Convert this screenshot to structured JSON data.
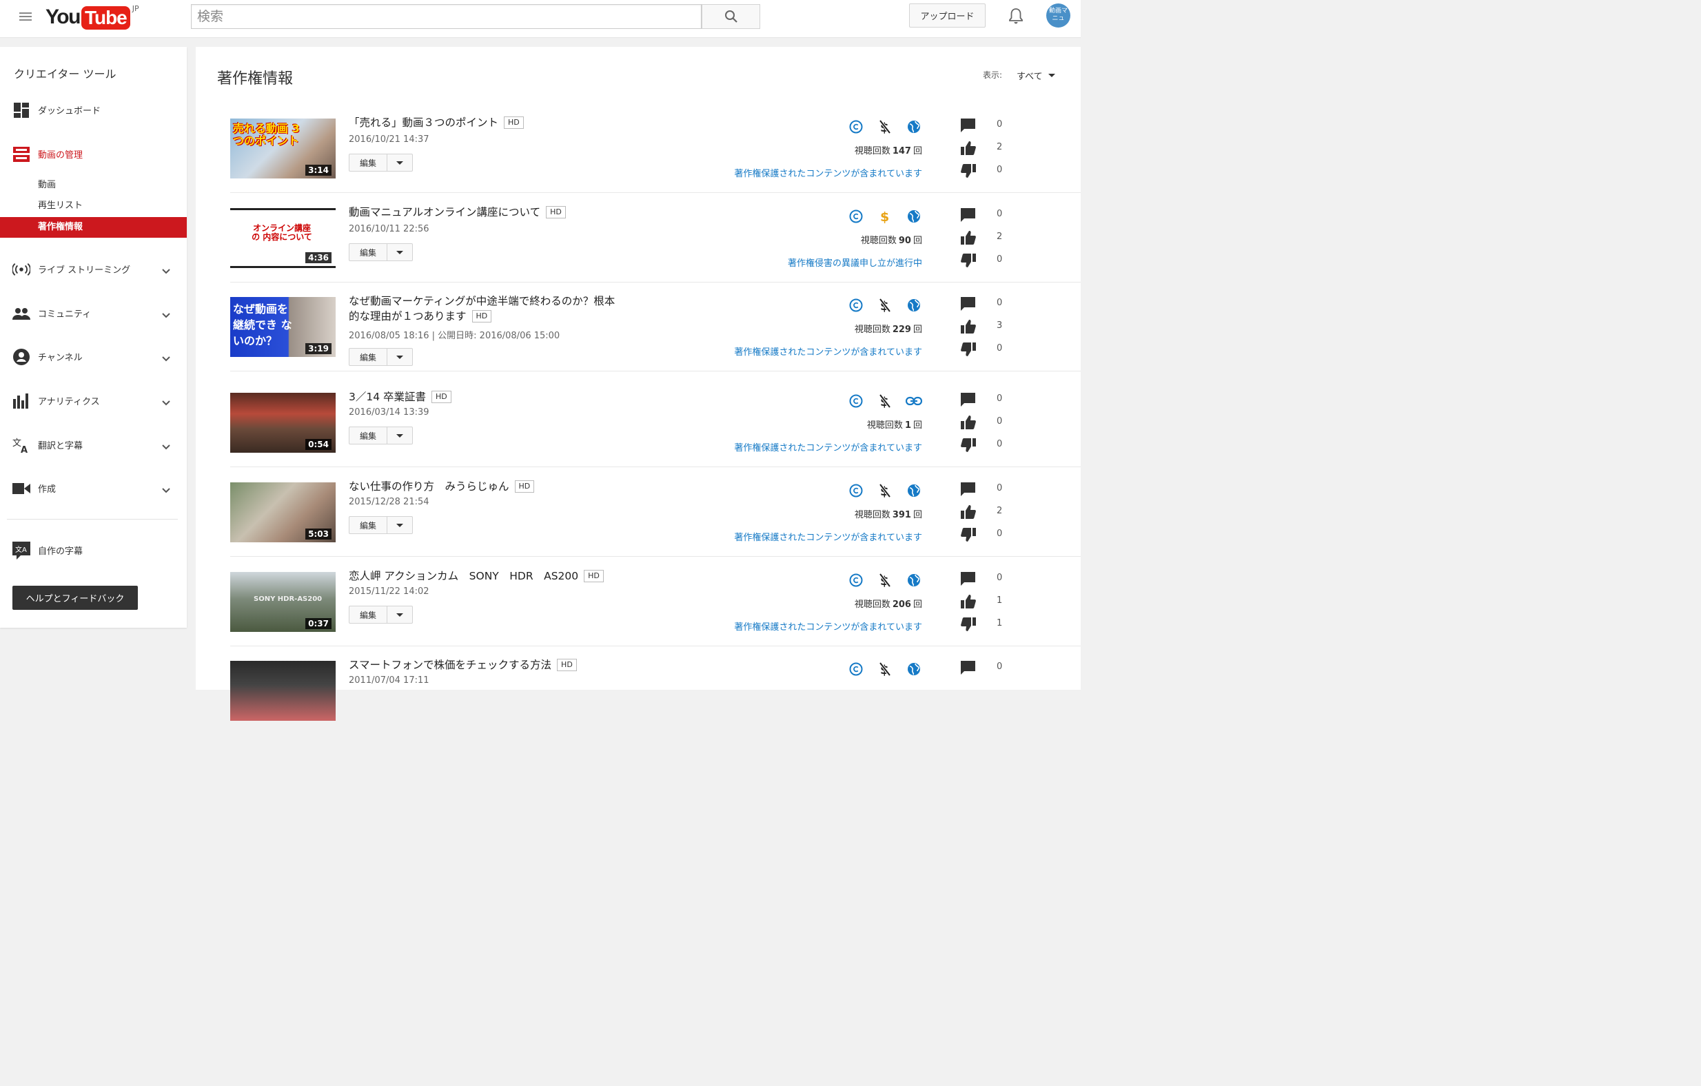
{
  "header": {
    "logo_you": "You",
    "logo_tube": "Tube",
    "logo_region": "JP",
    "search_placeholder": "検索",
    "upload_label": "アップロード",
    "avatar_text": "動画マニュ"
  },
  "sidebar": {
    "title": "クリエイター ツール",
    "items": [
      {
        "label": "ダッシュボード",
        "icon": "dashboard-icon"
      },
      {
        "label": "動画の管理",
        "icon": "video-manager-icon",
        "active": true
      },
      {
        "label": "ライブ ストリーミング",
        "icon": "live-streaming-icon"
      },
      {
        "label": "コミュニティ",
        "icon": "community-icon"
      },
      {
        "label": "チャンネル",
        "icon": "channel-icon"
      },
      {
        "label": "アナリティクス",
        "icon": "analytics-icon"
      },
      {
        "label": "翻訳と字幕",
        "icon": "translate-icon"
      },
      {
        "label": "作成",
        "icon": "create-icon"
      }
    ],
    "sub_items": [
      "動画",
      "再生リスト",
      "著作権情報"
    ],
    "own_subtitles": "自作の字幕",
    "help_label": "ヘルプとフィードバック"
  },
  "main": {
    "title": "著作権情報",
    "filter_label": "表示:",
    "filter_value": "すべて",
    "hd_label": "HD",
    "edit_label": "編集",
    "views_prefix": "視聴回数",
    "views_suffix": "回"
  },
  "colors": {
    "accent_red": "#cc181e",
    "link_blue": "#167ac6",
    "monetize_gold": "#e8a317"
  },
  "videos": [
    {
      "title": "「売れる」動画３つのポイント",
      "date": "2016/10/21 14:37",
      "duration": "3:14",
      "views": "147",
      "monetization": "not-monetized",
      "visibility": "public",
      "claim": "著作権保護されたコンテンツが含まれています",
      "comments": "0",
      "likes": "2",
      "dislikes": "0",
      "thumb_text": "売れる動画 3つのポイント"
    },
    {
      "title": "動画マニュアルオンライン講座について",
      "date": "2016/10/11 22:56",
      "duration": "4:36",
      "views": "90",
      "monetization": "monetized",
      "visibility": "public",
      "claim": "著作権侵害の異議申し立が進行中",
      "comments": "0",
      "likes": "2",
      "dislikes": "0",
      "thumb_text": "オンライン講座の 内容について"
    },
    {
      "title": "なぜ動画マーケティングが中途半端で終わるのか？根本的な理由が１つあります",
      "date": "2016/08/05 18:16 | 公開日時: 2016/08/06 15:00",
      "duration": "3:19",
      "views": "229",
      "monetization": "not-monetized",
      "visibility": "public",
      "claim": "著作権保護されたコンテンツが含まれています",
      "comments": "0",
      "likes": "3",
      "dislikes": "0",
      "thumb_text": "なぜ動画を 継続でき ないのか？"
    },
    {
      "title": "3／14 卒業証書",
      "date": "2016/03/14 13:39",
      "duration": "0:54",
      "views": "1",
      "monetization": "not-monetized",
      "visibility": "unlisted",
      "claim": "著作権保護されたコンテンツが含まれています",
      "comments": "0",
      "likes": "0",
      "dislikes": "0",
      "thumb_text": ""
    },
    {
      "title": "ない仕事の作り方　みうらじゅん",
      "date": "2015/12/28 21:54",
      "duration": "5:03",
      "views": "391",
      "monetization": "not-monetized",
      "visibility": "public",
      "claim": "著作権保護されたコンテンツが含まれています",
      "comments": "0",
      "likes": "2",
      "dislikes": "0",
      "thumb_text": ""
    },
    {
      "title": "恋人岬 アクションカム　SONY　HDR　AS200",
      "date": "2015/11/22 14:02",
      "duration": "0:37",
      "views": "206",
      "monetization": "not-monetized",
      "visibility": "public",
      "claim": "著作権保護されたコンテンツが含まれています",
      "comments": "0",
      "likes": "1",
      "dislikes": "1",
      "thumb_text": "SONY HDR-AS200"
    },
    {
      "title": "スマートフォンで株価をチェックする方法",
      "date": "2011/07/04 17:11",
      "duration": "",
      "views": "",
      "monetization": "not-monetized",
      "visibility": "public",
      "claim": "",
      "comments": "0",
      "likes": "",
      "dislikes": "",
      "thumb_text": ""
    }
  ]
}
